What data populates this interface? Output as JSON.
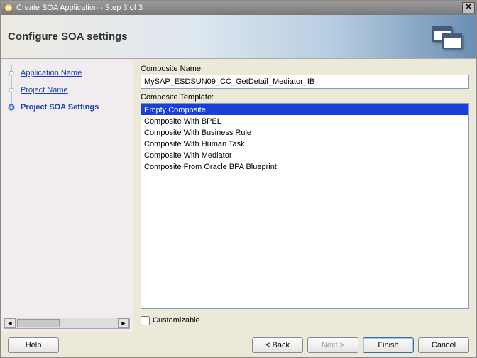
{
  "window": {
    "title": "Create SOA Application - Step 3 of 3"
  },
  "header": {
    "title": "Configure SOA settings"
  },
  "sidebar": {
    "items": [
      {
        "label": "Application Name",
        "active": false
      },
      {
        "label": "Project Name",
        "active": false
      },
      {
        "label": "Project SOA Settings",
        "active": true
      }
    ]
  },
  "form": {
    "name_label_pre": "Composite ",
    "name_label_key": "N",
    "name_label_post": "ame:",
    "name_value": "MySAP_ESDSUN09_CC_GetDetail_Mediator_IB",
    "template_label": "Composite Template:",
    "templates": [
      "Empty Composite",
      "Composite With BPEL",
      "Composite With Business Rule",
      "Composite With Human Task",
      "Composite With Mediator",
      "Composite From Oracle BPA Blueprint"
    ],
    "selected_template": 0,
    "customizable_label": "Customizable",
    "customizable_checked": false
  },
  "footer": {
    "help": "Help",
    "back": "< Back",
    "next": "Next >",
    "finish": "Finish",
    "cancel": "Cancel"
  }
}
